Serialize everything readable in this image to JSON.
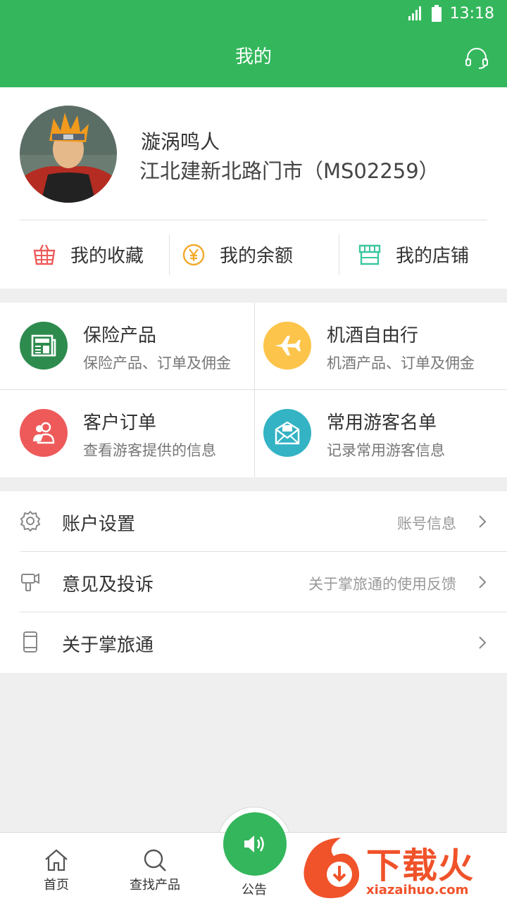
{
  "status_bar": {
    "time": "13:18"
  },
  "header": {
    "title": "我的"
  },
  "profile": {
    "name": "漩涡鸣人",
    "store": "江北建新北路门市（MS02259）"
  },
  "quick_links": [
    {
      "label": "我的收藏",
      "icon": "basket-icon"
    },
    {
      "label": "我的余额",
      "icon": "yen-icon"
    },
    {
      "label": "我的店铺",
      "icon": "store-icon"
    }
  ],
  "services": [
    {
      "title": "保险产品",
      "subtitle": "保险产品、订单及佣金",
      "icon": "newspaper-icon",
      "color": "#2e8b4e"
    },
    {
      "title": "机酒自由行",
      "subtitle": "机酒产品、订单及佣金",
      "icon": "airplane-icon",
      "color": "#fcc44a"
    },
    {
      "title": "客户订单",
      "subtitle": "查看游客提供的信息",
      "icon": "users-icon",
      "color": "#ee5a5a"
    },
    {
      "title": "常用游客名单",
      "subtitle": "记录常用游客信息",
      "icon": "envelope-icon",
      "color": "#33b3c4"
    }
  ],
  "settings": [
    {
      "label": "账户设置",
      "hint": "账号信息",
      "icon": "gear-icon"
    },
    {
      "label": "意见及投诉",
      "hint": "关于掌旅通的使用反馈",
      "icon": "megaphone-icon"
    },
    {
      "label": "关于掌旅通",
      "hint": "",
      "icon": "phone-icon"
    }
  ],
  "tabs": {
    "home": "首页",
    "search": "查找产品",
    "notice": "公告"
  },
  "watermark": {
    "text": "下载火",
    "url": "xiazaihuo.com"
  },
  "colors": {
    "brand": "#34b75c",
    "background": "#efefef"
  }
}
